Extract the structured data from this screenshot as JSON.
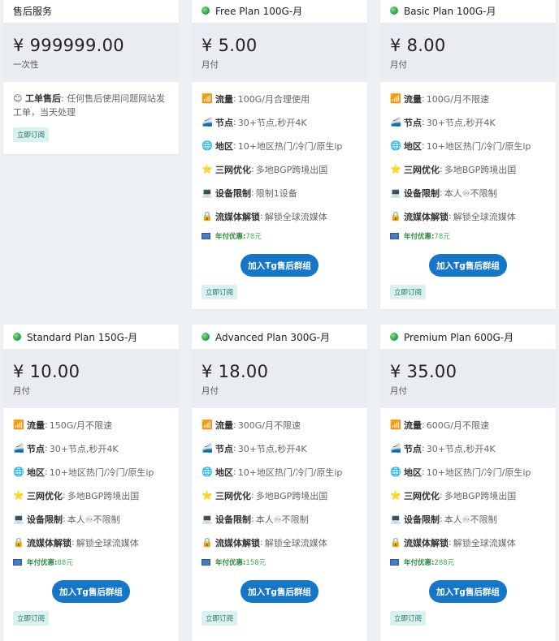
{
  "support_card": {
    "title": "售后服务",
    "price": "¥ 999999.00",
    "cycle": "一次性",
    "feature_icon": "😊",
    "feature_label": "工单售后",
    "feature_sep": ":",
    "feature_text": "任何售后使用问题网站发工单，当天处理",
    "subscribe_label": "立即订阅"
  },
  "common": {
    "tg_button": "加入Tg售后群组",
    "subscribe_label": "立即订阅",
    "discount_label": "年付优惠:",
    "feature_labels": [
      "流量",
      "节点",
      "地区",
      "三网优化",
      "设备限制",
      "流媒体解锁"
    ],
    "feature_icons": [
      "📶",
      "🚄",
      "🌐",
      "⭐",
      "💻",
      "🔒"
    ],
    "sep": ":"
  },
  "plans": [
    {
      "name": "Free Plan 100G-月",
      "price": "¥ 5.00",
      "cycle": "月付",
      "traffic": "100G/月合理使用",
      "nodes": "30+节点,秒开4K",
      "region": "10+地区热门/冷门/原生ip",
      "optimize": "多地BGP跨境出国",
      "device": "限制1设备",
      "media": "解锁全球流媒体",
      "discount": "78元"
    },
    {
      "name": "Basic Plan 100G-月",
      "price": "¥ 8.00",
      "cycle": "月付",
      "traffic": "100G/月不限速",
      "nodes": "30+节点,秒开4K",
      "region": "10+地区热门/冷门/原生ip",
      "optimize": "多地BGP跨境出国",
      "device": "本人♾不限制",
      "media": "解锁全球流媒体",
      "discount": "78元"
    },
    {
      "name": "Standard Plan 150G-月",
      "price": "¥ 10.00",
      "cycle": "月付",
      "traffic": "150G/月不限速",
      "nodes": "30+节点,秒开4K",
      "region": "10+地区热门/冷门/原生ip",
      "optimize": "多地BGP跨境出国",
      "device": "本人♾不限制",
      "media": "解锁全球流媒体",
      "discount": "88元"
    },
    {
      "name": "Advanced Plan 300G-月",
      "price": "¥ 18.00",
      "cycle": "月付",
      "traffic": "300G/月不限速",
      "nodes": "30+节点,秒开4K",
      "region": "10+地区热门/冷门/原生ip",
      "optimize": "多地BGP跨境出国",
      "device": "本人♾不限制",
      "media": "解锁全球流媒体",
      "discount": "158元"
    },
    {
      "name": "Premium Plan 600G-月",
      "price": "¥ 35.00",
      "cycle": "月付",
      "traffic": "600G/月不限速",
      "nodes": "30+节点,秒开4K",
      "region": "10+地区热门/冷门/原生ip",
      "optimize": "多地BGP跨境出国",
      "device": "本人♾不限制",
      "media": "解锁全球流媒体",
      "discount": "288元"
    }
  ]
}
